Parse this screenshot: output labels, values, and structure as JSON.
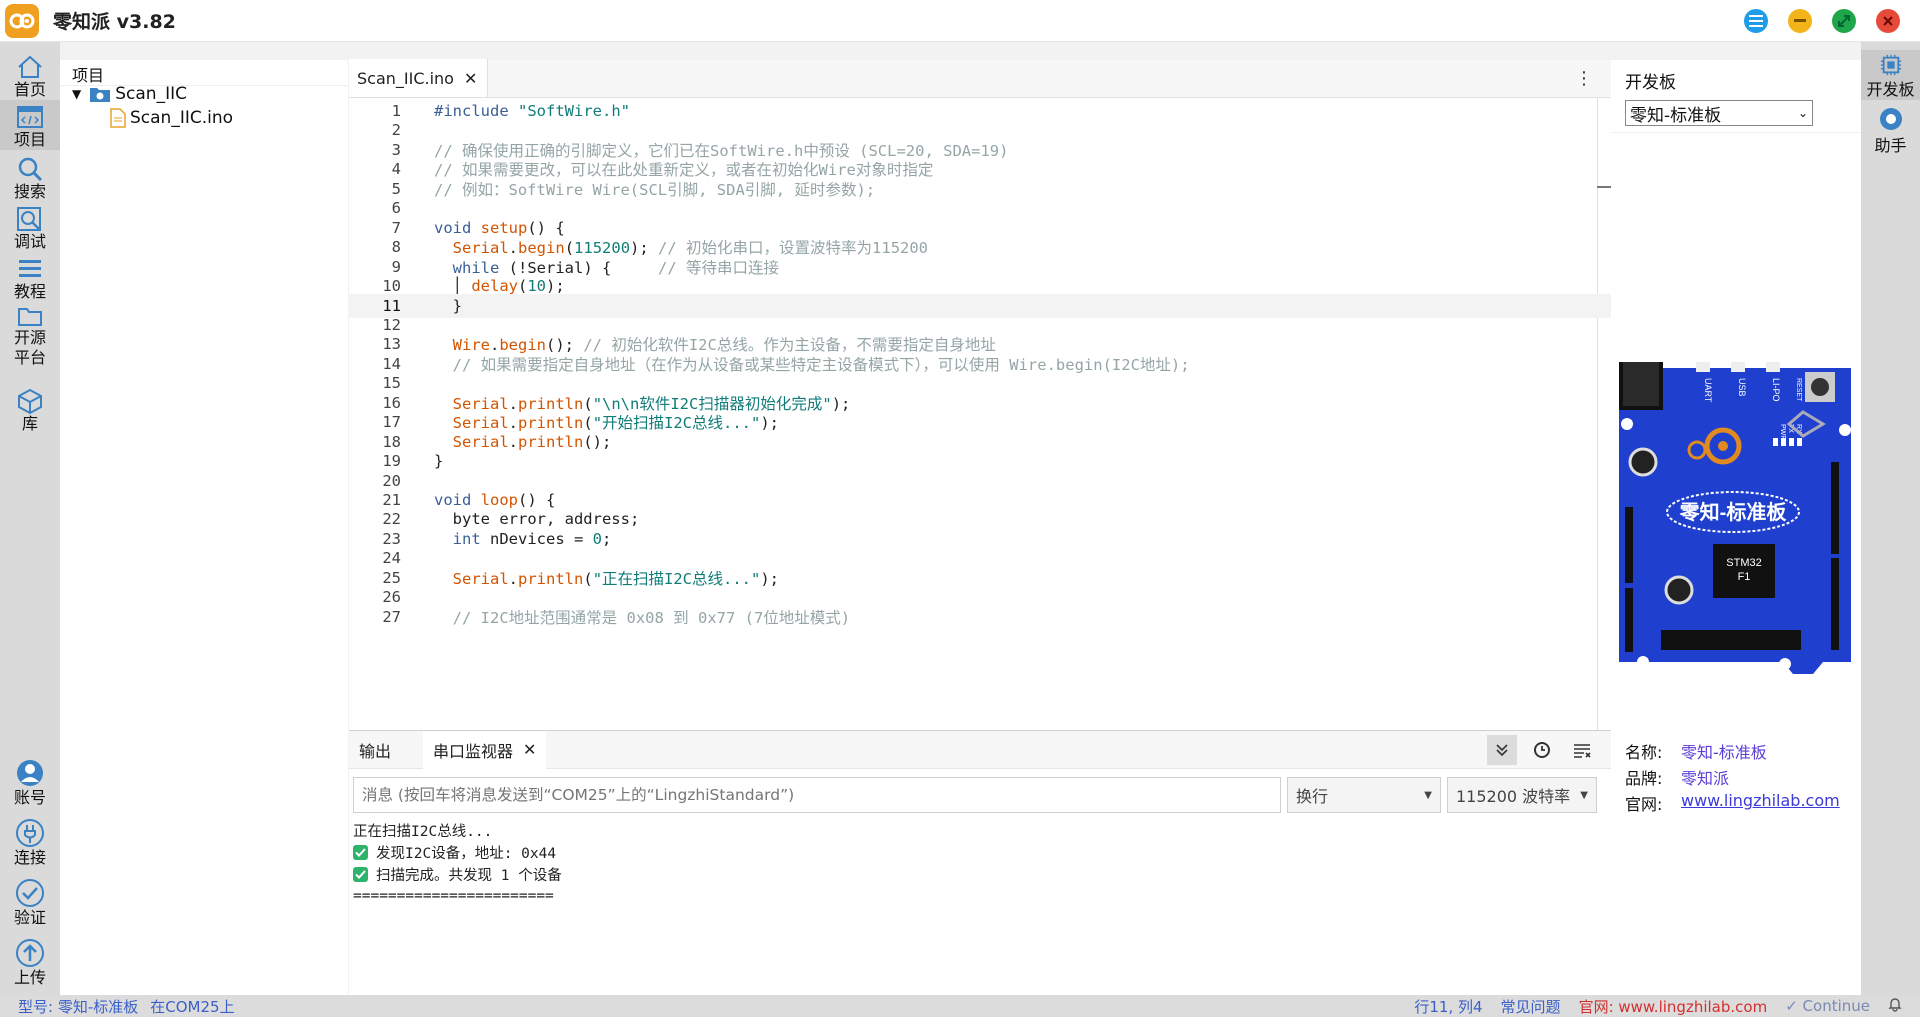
{
  "app": {
    "title": "零知派 v3.82"
  },
  "activity": [
    {
      "id": "home",
      "label": "首页"
    },
    {
      "id": "project",
      "label": "项目"
    },
    {
      "id": "search",
      "label": "搜索"
    },
    {
      "id": "debug",
      "label": "调试"
    },
    {
      "id": "tutorial",
      "label": "教程"
    },
    {
      "id": "opensource",
      "label": "开源\n平台"
    },
    {
      "id": "library",
      "label": "库"
    },
    {
      "id": "account",
      "label": "账号"
    },
    {
      "id": "connect",
      "label": "连接"
    },
    {
      "id": "verify",
      "label": "验证"
    },
    {
      "id": "upload",
      "label": "上传"
    }
  ],
  "project": {
    "header": "项目",
    "folder": "Scan_IIC",
    "file": "Scan_IIC.ino"
  },
  "editor": {
    "tab_label": "Scan_IIC.ino",
    "more_icon": "⋮",
    "current_line": 11,
    "lines": [
      {
        "n": "1",
        "segs": [
          [
            "k",
            "#include "
          ],
          [
            "s",
            "\"SoftWire.h\""
          ]
        ]
      },
      {
        "n": "2",
        "segs": []
      },
      {
        "n": "3",
        "segs": [
          [
            "c",
            "// 确保使用正确的引脚定义，它们已在SoftWire.h中预设 (SCL=20, SDA=19)"
          ]
        ]
      },
      {
        "n": "4",
        "segs": [
          [
            "c",
            "// 如果需要更改，可以在此处重新定义，或者在初始化Wire对象时指定"
          ]
        ]
      },
      {
        "n": "5",
        "segs": [
          [
            "c",
            "// 例如：SoftWire Wire(SCL引脚, SDA引脚, 延时参数);"
          ]
        ]
      },
      {
        "n": "6",
        "segs": []
      },
      {
        "n": "7",
        "segs": [
          [
            "k",
            "void "
          ],
          [
            "f",
            "setup"
          ],
          [
            "t",
            "() {"
          ]
        ]
      },
      {
        "n": "8",
        "segs": [
          [
            "t",
            "  "
          ],
          [
            "f",
            "Serial"
          ],
          [
            "t",
            "."
          ],
          [
            "f",
            "begin"
          ],
          [
            "t",
            "("
          ],
          [
            "n",
            "115200"
          ],
          [
            "t",
            "); "
          ],
          [
            "c",
            "// 初始化串口，设置波特率为115200"
          ]
        ]
      },
      {
        "n": "9",
        "segs": [
          [
            "t",
            "  "
          ],
          [
            "k",
            "while"
          ],
          [
            "t",
            " (!Serial) {     "
          ],
          [
            "c",
            "// 等待串口连接"
          ]
        ]
      },
      {
        "n": "10",
        "segs": [
          [
            "t",
            "  │ "
          ],
          [
            "f",
            "delay"
          ],
          [
            "t",
            "("
          ],
          [
            "n",
            "10"
          ],
          [
            "t",
            ");"
          ]
        ]
      },
      {
        "n": "11",
        "segs": [
          [
            "t",
            "  }"
          ]
        ]
      },
      {
        "n": "12",
        "segs": []
      },
      {
        "n": "13",
        "segs": [
          [
            "t",
            "  "
          ],
          [
            "f",
            "Wire"
          ],
          [
            "t",
            "."
          ],
          [
            "f",
            "begin"
          ],
          [
            "t",
            "(); "
          ],
          [
            "c",
            "// 初始化软件I2C总线。作为主设备，不需要指定自身地址"
          ]
        ]
      },
      {
        "n": "14",
        "segs": [
          [
            "t",
            "  "
          ],
          [
            "c",
            "// 如果需要指定自身地址（在作为从设备或某些特定主设备模式下），可以使用 Wire.begin(I2C地址);"
          ]
        ]
      },
      {
        "n": "15",
        "segs": []
      },
      {
        "n": "16",
        "segs": [
          [
            "t",
            "  "
          ],
          [
            "f",
            "Serial"
          ],
          [
            "t",
            "."
          ],
          [
            "f",
            "println"
          ],
          [
            "t",
            "("
          ],
          [
            "s",
            "\"\\n\\n软件I2C扫描器初始化完成\""
          ],
          [
            "t",
            ");"
          ]
        ]
      },
      {
        "n": "17",
        "segs": [
          [
            "t",
            "  "
          ],
          [
            "f",
            "Serial"
          ],
          [
            "t",
            "."
          ],
          [
            "f",
            "println"
          ],
          [
            "t",
            "("
          ],
          [
            "s",
            "\"开始扫描I2C总线...\""
          ],
          [
            "t",
            ");"
          ]
        ]
      },
      {
        "n": "18",
        "segs": [
          [
            "t",
            "  "
          ],
          [
            "f",
            "Serial"
          ],
          [
            "t",
            "."
          ],
          [
            "f",
            "println"
          ],
          [
            "t",
            "();"
          ]
        ]
      },
      {
        "n": "19",
        "segs": [
          [
            "t",
            "}"
          ]
        ]
      },
      {
        "n": "20",
        "segs": []
      },
      {
        "n": "21",
        "segs": [
          [
            "k",
            "void "
          ],
          [
            "f",
            "loop"
          ],
          [
            "t",
            "() {"
          ]
        ]
      },
      {
        "n": "22",
        "segs": [
          [
            "t",
            "  byte error, address;"
          ]
        ]
      },
      {
        "n": "23",
        "segs": [
          [
            "t",
            "  "
          ],
          [
            "k",
            "int"
          ],
          [
            "t",
            " nDevices = "
          ],
          [
            "n",
            "0"
          ],
          [
            "t",
            ";"
          ]
        ]
      },
      {
        "n": "24",
        "segs": []
      },
      {
        "n": "25",
        "segs": [
          [
            "t",
            "  "
          ],
          [
            "f",
            "Serial"
          ],
          [
            "t",
            "."
          ],
          [
            "f",
            "println"
          ],
          [
            "t",
            "("
          ],
          [
            "s",
            "\"正在扫描I2C总线...\""
          ],
          [
            "t",
            ");"
          ]
        ]
      },
      {
        "n": "26",
        "segs": []
      },
      {
        "n": "27",
        "segs": [
          [
            "t",
            "  "
          ],
          [
            "c",
            "// I2C地址范围通常是 0x08 到 0x77 (7位地址模式)"
          ]
        ]
      }
    ]
  },
  "bottom": {
    "tab_output": "输出",
    "tab_serial": "串口监视器",
    "message_placeholder": "消息 (按回车将消息发送到“COM25”上的“LingzhiStandard”)",
    "line_ending": "换行",
    "baud": "115200 波特率",
    "serial_lines": [
      {
        "text": "正在扫描I2C总线...",
        "check": false
      },
      {
        "text": "发现I2C设备，地址: 0x44",
        "check": true
      },
      {
        "text": "扫描完成。共发现 1 个设备",
        "check": true
      },
      {
        "text": "=======================",
        "check": false
      }
    ]
  },
  "right": {
    "title": "开发板",
    "board_select": "零知-标准板",
    "board_name_on_img": "零知-标准板",
    "board_chip": "STM32",
    "board_chip2": "F1",
    "board_labels": {
      "uart": "UART",
      "usb": "USB",
      "lipo": "LI-PO",
      "reset": "RESET",
      "pwr": "PWR",
      "tx": "TX",
      "rx": "RX"
    },
    "info": [
      {
        "k": "名称:",
        "v": "零知-标准板"
      },
      {
        "k": "品牌:",
        "v": "零知派"
      },
      {
        "k": "官网:",
        "v": "www.lingzhilab.com"
      }
    ]
  },
  "rightbar": [
    {
      "id": "board",
      "label": "开发板"
    },
    {
      "id": "assistant",
      "label": "助手"
    }
  ],
  "status": {
    "model": "型号: 零知-标准板",
    "port": "在COM25上",
    "cursor": "行11, 列4",
    "faq": "常见问题",
    "site": "官网: www.lingzhilab.com",
    "continue": "Continue"
  },
  "colors": {
    "accent": "#3b82c4",
    "board_blue": "#1f3fcf",
    "brand_orange": "#f0a020"
  }
}
